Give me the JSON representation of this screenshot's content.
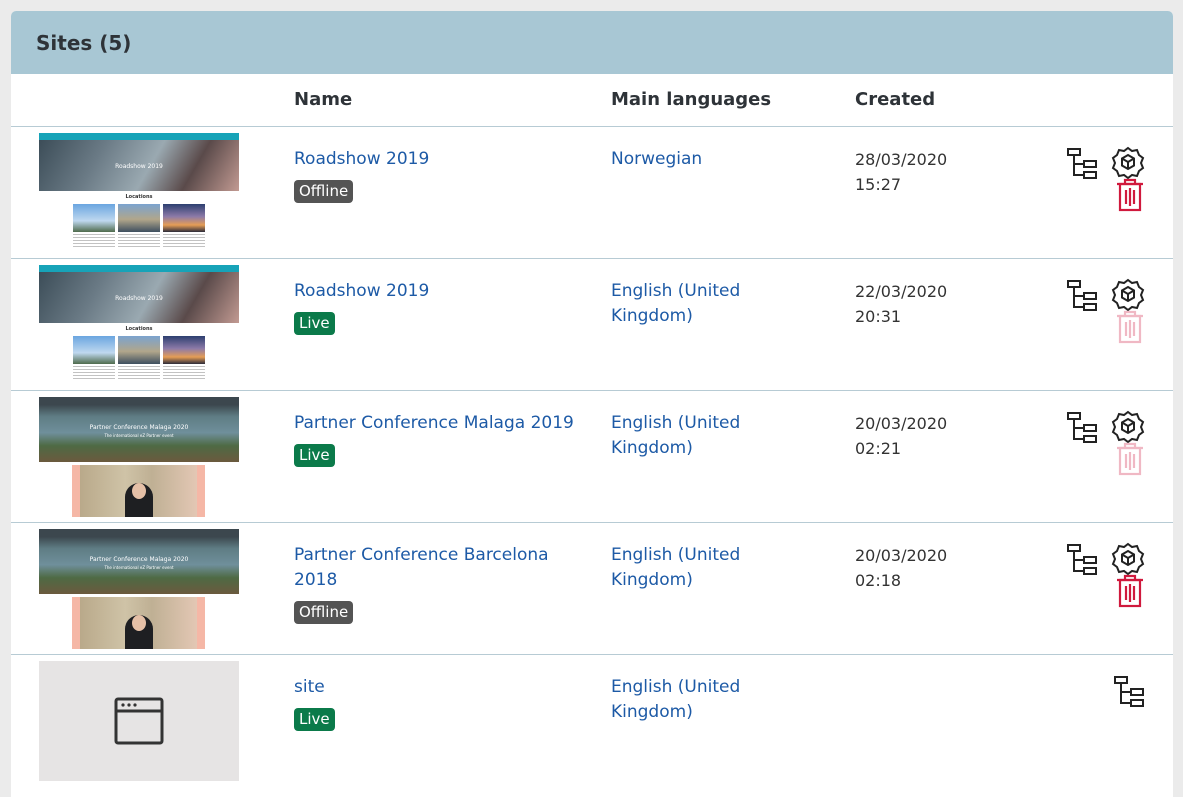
{
  "panel": {
    "title": "Sites (5)"
  },
  "columns": {
    "name": "Name",
    "languages": "Main languages",
    "created": "Created"
  },
  "rows": [
    {
      "name": "Roadshow 2019",
      "status": "Offline",
      "language": "Norwegian",
      "date": "28/03/2020",
      "time": "15:27",
      "thumb_title": "Roadshow 2019",
      "thumb_section": "Locations",
      "delete_enabled": true
    },
    {
      "name": "Roadshow 2019",
      "status": "Live",
      "language": "English (United Kingdom)",
      "date": "22/03/2020",
      "time": "20:31",
      "thumb_title": "Roadshow 2019",
      "thumb_section": "Locations",
      "delete_enabled": false
    },
    {
      "name": "Partner Conference Malaga 2019",
      "status": "Live",
      "language": "English (United Kingdom)",
      "date": "20/03/2020",
      "time": "02:21",
      "thumb_title": "Partner Conference Malaga 2020",
      "thumb_subtitle": "The international eZ Partner event",
      "delete_enabled": false
    },
    {
      "name": "Partner Conference Barcelona 2018",
      "status": "Offline",
      "language": "English (United Kingdom)",
      "date": "20/03/2020",
      "time": "02:18",
      "thumb_title": "Partner Conference Malaga 2020",
      "thumb_subtitle": "The international eZ Partner event",
      "delete_enabled": true
    },
    {
      "name": "site",
      "status": "Live",
      "language": "English (United Kingdom)",
      "date": "",
      "time": "",
      "delete_enabled": false
    }
  ],
  "icons": {
    "tree": "tree-structure-icon",
    "settings": "gear-icon",
    "delete": "trash-icon",
    "placeholder": "browser-window-icon"
  },
  "colors": {
    "header_bg": "#a8c7d4",
    "link": "#1d5aa6",
    "live": "#0b7a4a",
    "offline": "#545454",
    "delete": "#d0193d",
    "delete_disabled": "#f0b8c4"
  }
}
